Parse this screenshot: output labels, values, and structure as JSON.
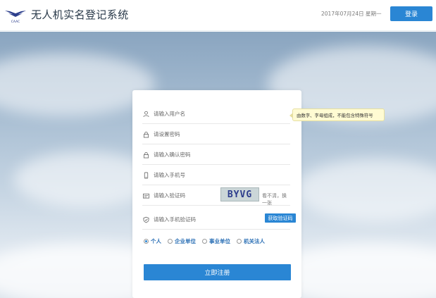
{
  "header": {
    "logo_text": "CAAC",
    "title": "无人机实名登记系统",
    "date": "2017年07月24日 星期一",
    "login_label": "登录"
  },
  "form": {
    "username_placeholder": "请输入用户名",
    "password_placeholder": "请设置密码",
    "confirm_password_placeholder": "请输入确认密码",
    "phone_placeholder": "请输入手机号",
    "captcha_placeholder": "请输入验证码",
    "captcha_text": "BYVG",
    "captcha_refresh": "看不清，换一张",
    "sms_code_placeholder": "请输入手机验证码",
    "get_code_label": "获取验证码",
    "tooltip": "由数字、字母组成，不能包含特殊符号",
    "user_types": [
      {
        "label": "个人",
        "selected": true
      },
      {
        "label": "企业单位",
        "selected": false
      },
      {
        "label": "事业单位",
        "selected": false
      },
      {
        "label": "机关法人",
        "selected": false
      }
    ],
    "submit_label": "立即注册"
  },
  "colors": {
    "accent": "#2a86d4",
    "tooltip_bg": "#fffbd3"
  }
}
